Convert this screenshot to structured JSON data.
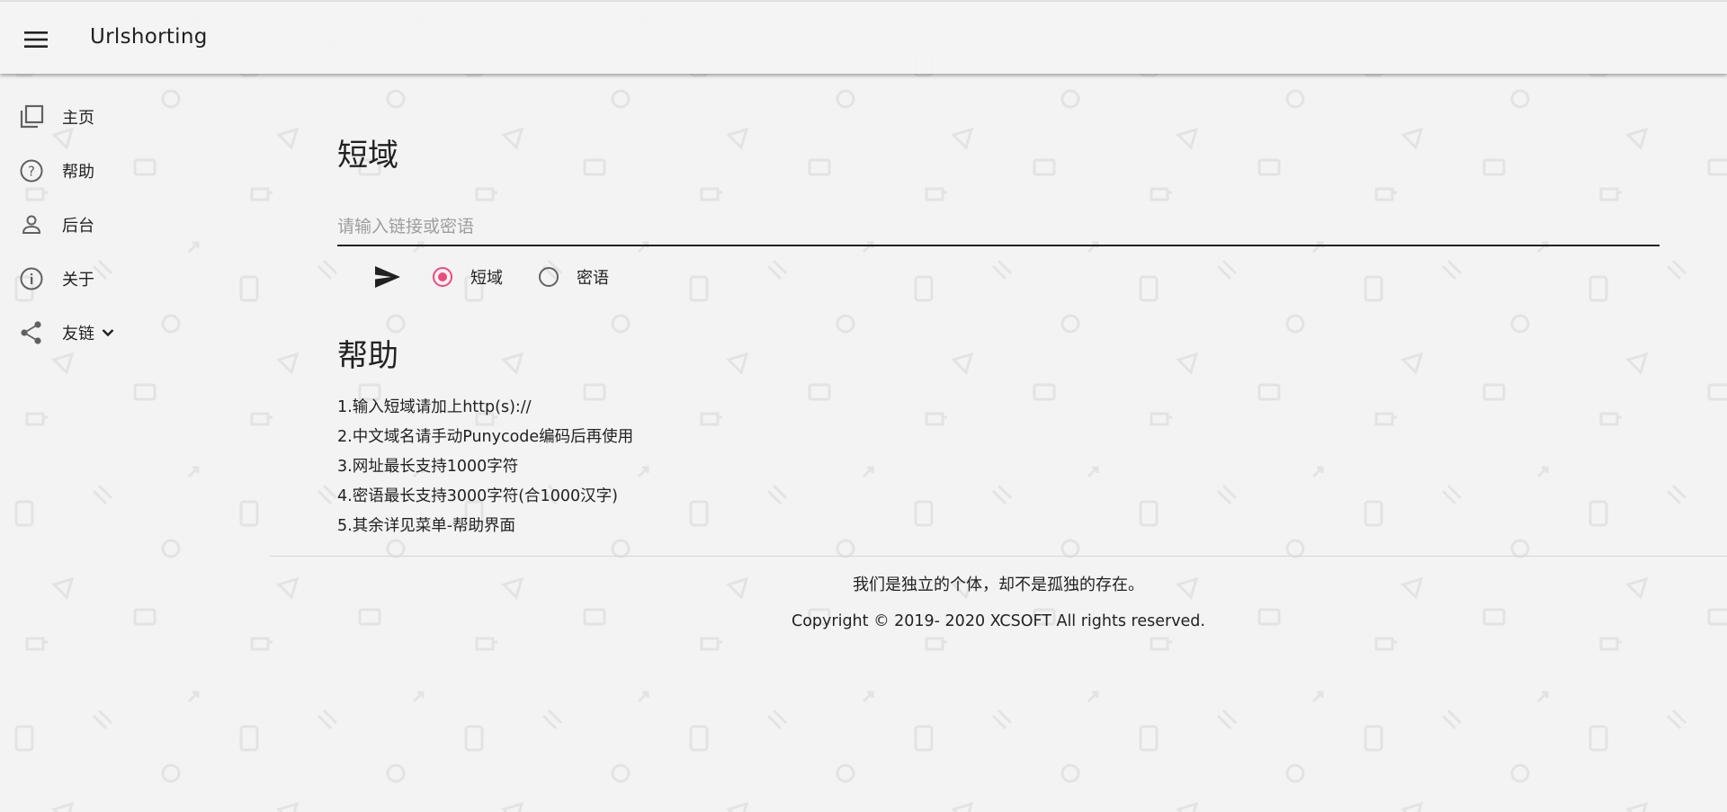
{
  "header": {
    "title": "Urlshorting",
    "menu_icon": "hamburger-menu-icon"
  },
  "sidebar": {
    "items": [
      {
        "label": "主页",
        "icon": "library-icon"
      },
      {
        "label": "帮助",
        "icon": "help-circle-icon"
      },
      {
        "label": "后台",
        "icon": "person-icon"
      },
      {
        "label": "关于",
        "icon": "info-icon"
      },
      {
        "label": "友链",
        "icon": "share-icon"
      }
    ]
  },
  "shorten": {
    "title": "短域",
    "placeholder": "请输入链接或密语",
    "value": "",
    "send_icon": "send-icon",
    "options": [
      {
        "label": "短域",
        "selected": true
      },
      {
        "label": "密语",
        "selected": false
      }
    ]
  },
  "help": {
    "title": "帮助",
    "items": [
      "1.输入短域请加上http(s)://",
      "2.中文域名请手动Punycode编码后再使用",
      "3.网址最长支持1000字符",
      "4.密语最长支持3000字符(合1000汉字)",
      "5.其余详见菜单-帮助界面"
    ]
  },
  "footer": {
    "motto": "我们是独立的个体，却不是孤独的存在。",
    "copyright": "Copyright © 2019- 2020 XCSOFT All rights reserved."
  },
  "colors": {
    "accent": "#ef4a7e",
    "background": "#f3f3f3",
    "text": "#212121"
  }
}
